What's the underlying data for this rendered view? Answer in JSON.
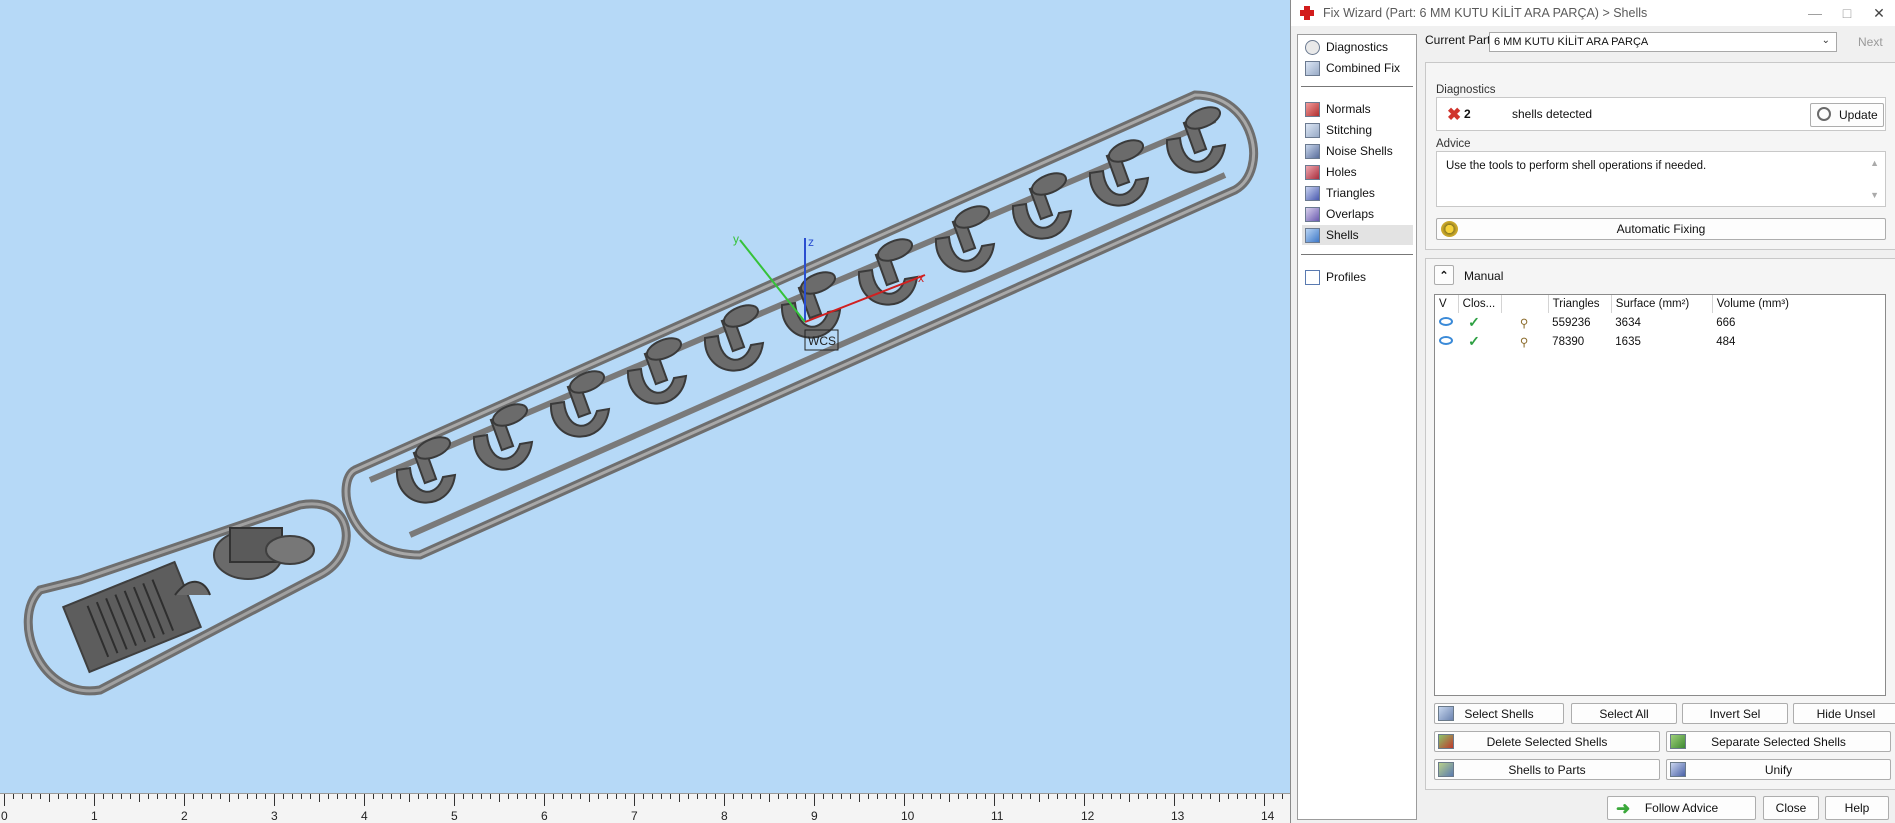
{
  "window": {
    "title": "Fix Wizard (Part: 6 MM KUTU KİLİT ARA PARÇA) > Shells"
  },
  "nav": {
    "items": [
      {
        "label": "Diagnostics"
      },
      {
        "label": "Combined Fix"
      },
      {
        "label": "Normals"
      },
      {
        "label": "Stitching"
      },
      {
        "label": "Noise Shells"
      },
      {
        "label": "Holes"
      },
      {
        "label": "Triangles"
      },
      {
        "label": "Overlaps"
      },
      {
        "label": "Shells"
      },
      {
        "label": "Profiles"
      }
    ],
    "active": "Shells"
  },
  "current_part": {
    "label": "Current Part:",
    "value": "6 MM KUTU KİLİT ARA PARÇA",
    "next_label": "Next"
  },
  "diagnostics": {
    "title": "Diagnostics",
    "count": "2",
    "message": "shells detected",
    "update_label": "Update",
    "advice_title": "Advice",
    "advice_text": "Use the tools to perform shell operations if needed.",
    "automatic_fixing_label": "Automatic Fixing"
  },
  "manual": {
    "title": "Manual",
    "columns": [
      "V",
      "Clos...",
      "",
      "Triangles",
      "Surface (mm²)",
      "Volume (mm³)"
    ],
    "rows": [
      {
        "triangles": "559236",
        "surface": "3634",
        "volume": "666"
      },
      {
        "triangles": "78390",
        "surface": "1635",
        "volume": "484"
      }
    ],
    "buttons": {
      "select_shells": "Select Shells",
      "select_all": "Select All",
      "invert_sel": "Invert Sel",
      "hide_unsel": "Hide Unsel",
      "delete_selected": "Delete Selected Shells",
      "separate_selected": "Separate Selected Shells",
      "shells_to_parts": "Shells to Parts",
      "unify": "Unify"
    }
  },
  "footer": {
    "follow_advice": "Follow Advice",
    "close": "Close",
    "help": "Help"
  },
  "viewport": {
    "axis_labels": {
      "x": "x",
      "y": "y",
      "z": "z"
    },
    "triad_label": "WCS",
    "ruler_labels": [
      "0",
      "1",
      "2",
      "3",
      "4",
      "5",
      "6",
      "7",
      "8",
      "9",
      "10",
      "11",
      "12",
      "13",
      "14"
    ]
  },
  "colors": {
    "viewport_bg": "#b6d9f7",
    "part_grey": "#6e6e6e",
    "error_red": "#d0342c",
    "check_green": "#2ea043"
  }
}
